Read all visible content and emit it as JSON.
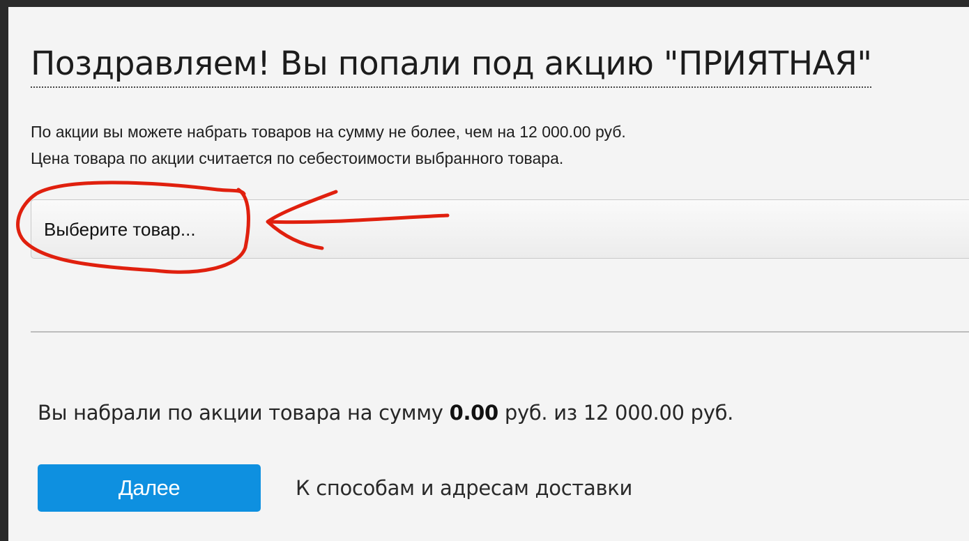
{
  "page": {
    "title": "Поздравляем! Вы попали под акцию \"ПРИЯТНАЯ\""
  },
  "info": {
    "line1": "По акции вы можете набрать товаров на сумму не более, чем на 12 000.00 руб.",
    "line2": "Цена товара по акции считается по себестоимости выбранного товара."
  },
  "product_select": {
    "value": "Выберите товар..."
  },
  "summary": {
    "prefix": "Вы набрали по акции товара на сумму",
    "amount": "0.00",
    "suffix": "руб. из 12 000.00 руб."
  },
  "actions": {
    "next_label": "Далее",
    "next_hint": "К способам и адресам доставки"
  },
  "colors": {
    "accent": "#0e90e0",
    "annotation": "#e0200e"
  }
}
